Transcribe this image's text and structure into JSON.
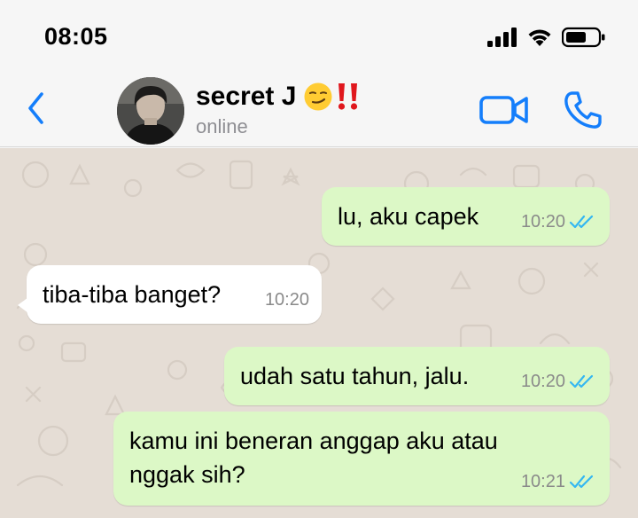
{
  "status_bar": {
    "time": "08:05"
  },
  "header": {
    "contact_name": "secret J",
    "contact_status": "online",
    "emoji": "😏‼️"
  },
  "colors": {
    "accent": "#147efb",
    "outgoing_bubble": "#dcf8c6",
    "incoming_bubble": "#ffffff",
    "chat_background": "#e5ddd5",
    "read_ticks": "#34b7f1"
  },
  "messages": [
    {
      "direction": "outgoing",
      "text": "lu, aku capek",
      "time": "10:20",
      "status": "read"
    },
    {
      "direction": "incoming",
      "text": "tiba-tiba banget?",
      "time": "10:20"
    },
    {
      "direction": "outgoing",
      "text": "udah satu tahun, jalu.",
      "time": "10:20",
      "status": "read"
    },
    {
      "direction": "outgoing",
      "text": "kamu ini beneran anggap aku atau nggak sih?",
      "time": "10:21",
      "status": "read"
    }
  ]
}
